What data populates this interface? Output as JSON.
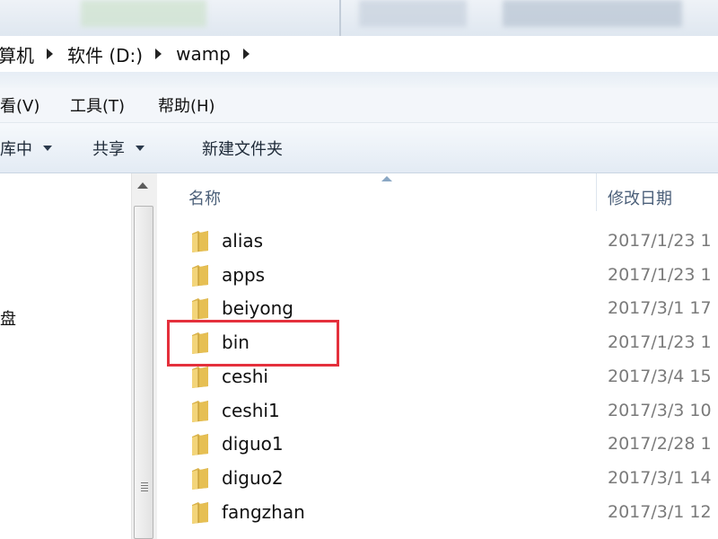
{
  "breadcrumb": {
    "items": [
      {
        "label": "算机"
      },
      {
        "label": "软件 (D:)"
      },
      {
        "label": "wamp"
      }
    ]
  },
  "menu": {
    "items": [
      {
        "label": "看(V)"
      },
      {
        "label": "工具(T)"
      },
      {
        "label": "帮助(H)"
      }
    ]
  },
  "toolbar": {
    "items": [
      {
        "label": "库中"
      },
      {
        "label": "共享"
      },
      {
        "label": "新建文件夹"
      }
    ]
  },
  "nav": {
    "partial_label": "盘"
  },
  "columns": {
    "name": "名称",
    "date": "修改日期"
  },
  "files": [
    {
      "name": "alias",
      "date": "2017/1/23 1"
    },
    {
      "name": "apps",
      "date": "2017/1/23 1"
    },
    {
      "name": "beiyong",
      "date": "2017/3/1 17"
    },
    {
      "name": "bin",
      "date": "2017/1/23 1"
    },
    {
      "name": "ceshi",
      "date": "2017/3/4 15"
    },
    {
      "name": "ceshi1",
      "date": "2017/3/3 10"
    },
    {
      "name": "diguo1",
      "date": "2017/2/28 1"
    },
    {
      "name": "diguo2",
      "date": "2017/3/1 14"
    },
    {
      "name": "fangzhan",
      "date": "2017/3/1 12"
    }
  ],
  "colors": {
    "highlight": "#e4303c",
    "header_text": "#4c607a",
    "date_text": "#7a7a7a"
  }
}
